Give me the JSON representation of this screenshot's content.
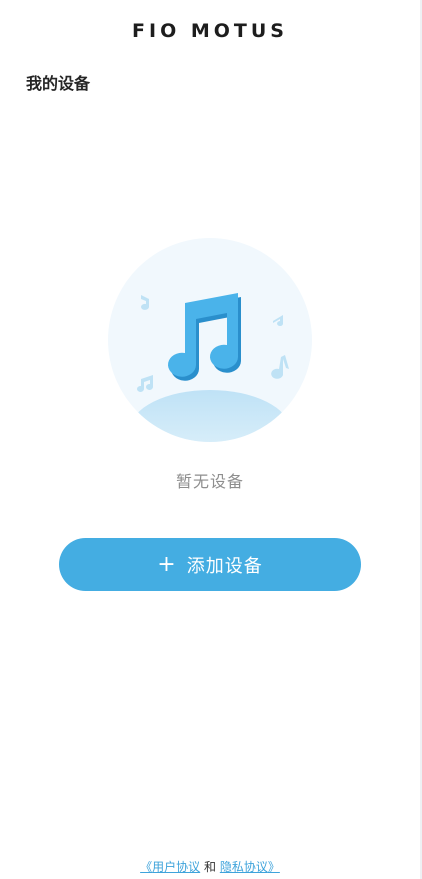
{
  "header": {
    "brand": "FIO MOTUS",
    "title": "我的设备"
  },
  "empty_state": {
    "icon": "music-note-icon",
    "text": "暂无设备"
  },
  "actions": {
    "add_icon": "+",
    "add_label": "添加设备"
  },
  "footer": {
    "open_bracket": "《",
    "user_agreement": "用户协议",
    "and": "和",
    "privacy_policy": "隐私协议",
    "close_bracket": "》"
  },
  "colors": {
    "accent": "#44ade2",
    "illustration_circle": "#f1f8fd",
    "note_main": "#41aee6",
    "note_light": "#bfe2f5"
  }
}
